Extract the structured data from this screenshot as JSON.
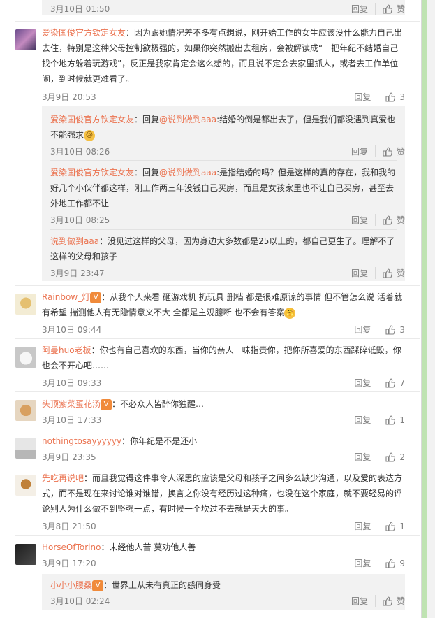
{
  "top_stub": {
    "time": "3月10日 01:50",
    "reply": "回复",
    "like": "赞"
  },
  "comments": [
    {
      "user": "爱染国俊官方钦定女友",
      "text": "：因为跟她情况差不多有点想说，刚开始工作的女生应该没什么能力自己出去住，特别是这种父母控制欲极强的，如果你突然搬出去租房，会被解读成“一把年纪不结婚自己找个地方躲着玩游戏”，反正是我家肯定会这么想的，而且说不定会去家里抓人，或者去工作单位闹，到时候就更难看了。",
      "time": "3月9日 20:53",
      "reply": "回复",
      "like": "3"
    },
    {
      "user": "Rainbow_灯",
      "text": "：从我个人来看 砸游戏机 扔玩具 删档 都是很难原谅的事情 但不管怎么说 活着就有希望 揣测他人有无隐情意义不大 全都是主观臆断 也不会有答案",
      "time": "3月10日 09:44",
      "reply": "回复",
      "like": "3"
    },
    {
      "user": "阿曼huo老板",
      "text": "：你也有自己喜欢的东西，当你的亲人一味指责你，把你所喜爱的东西踩碎诋毁，你也会不开心吧……",
      "time": "3月10日 09:33",
      "reply": "回复",
      "like": "7"
    },
    {
      "user": "头顶紫菜蛋花汤",
      "text": "：不必众人皆醉你独醒…",
      "time": "3月10日 17:33",
      "reply": "回复",
      "like": "1"
    },
    {
      "user": "nothingtosayyyyyy",
      "text": "：你年纪是不是还小",
      "time": "3月9日 23:35",
      "reply": "回复",
      "like": "2"
    },
    {
      "user": "先吃再说吧",
      "text": "：而且我觉得这件事令人深思的应该是父母和孩子之间多么缺少沟通，以及爱的表达方式，而不是现在来讨论谁对谁错，换言之你没有经历过这种痛，也没在这个家庭，就不要轻易的评论别人为什么做不到坚强一点，有时候一个坎过不去就是天大的事。",
      "time": "3月8日 21:50",
      "reply": "回复",
      "like": "1"
    },
    {
      "user": "HorseOfTorino",
      "text": "：未经他人苦 莫劝他人善",
      "time": "3月9日 17:20",
      "reply": "回复",
      "like": "9"
    }
  ],
  "replies": [
    {
      "user": "爱染国俊官方钦定女友",
      "reply_word": "：回复",
      "mention": "@说到做到aaa",
      "text": ":结婚的倒是都出去了，但是我们都没遇到真爱也不能强求",
      "time": "3月10日 08:26",
      "reply": "回复",
      "like": "赞"
    },
    {
      "user": "爱染国俊官方钦定女友",
      "reply_word": "：回复",
      "mention": "@说到做到aaa",
      "text": ":是指结婚的吗？但是这样的真的存在，我和我的好几个小伙伴都这样，刚工作两三年没钱自己买房，而且是女孩家里也不让自己买房，甚至去外地工作都不让",
      "time": "3月10日 08:25",
      "reply": "回复",
      "like": "赞"
    },
    {
      "user": "说到做到aaa",
      "text": "：没见过这样的父母，因为身边大多数都是25以上的，都自己更生了。理解不了这样的父母和孩子",
      "time": "3月9日 23:47",
      "reply": "回复",
      "like": "赞"
    },
    {
      "user": "小小小腰桑",
      "text": "：世界上从未有真正的感同身受",
      "time": "3月10日 02:24",
      "reply": "回复",
      "like": "赞"
    }
  ]
}
